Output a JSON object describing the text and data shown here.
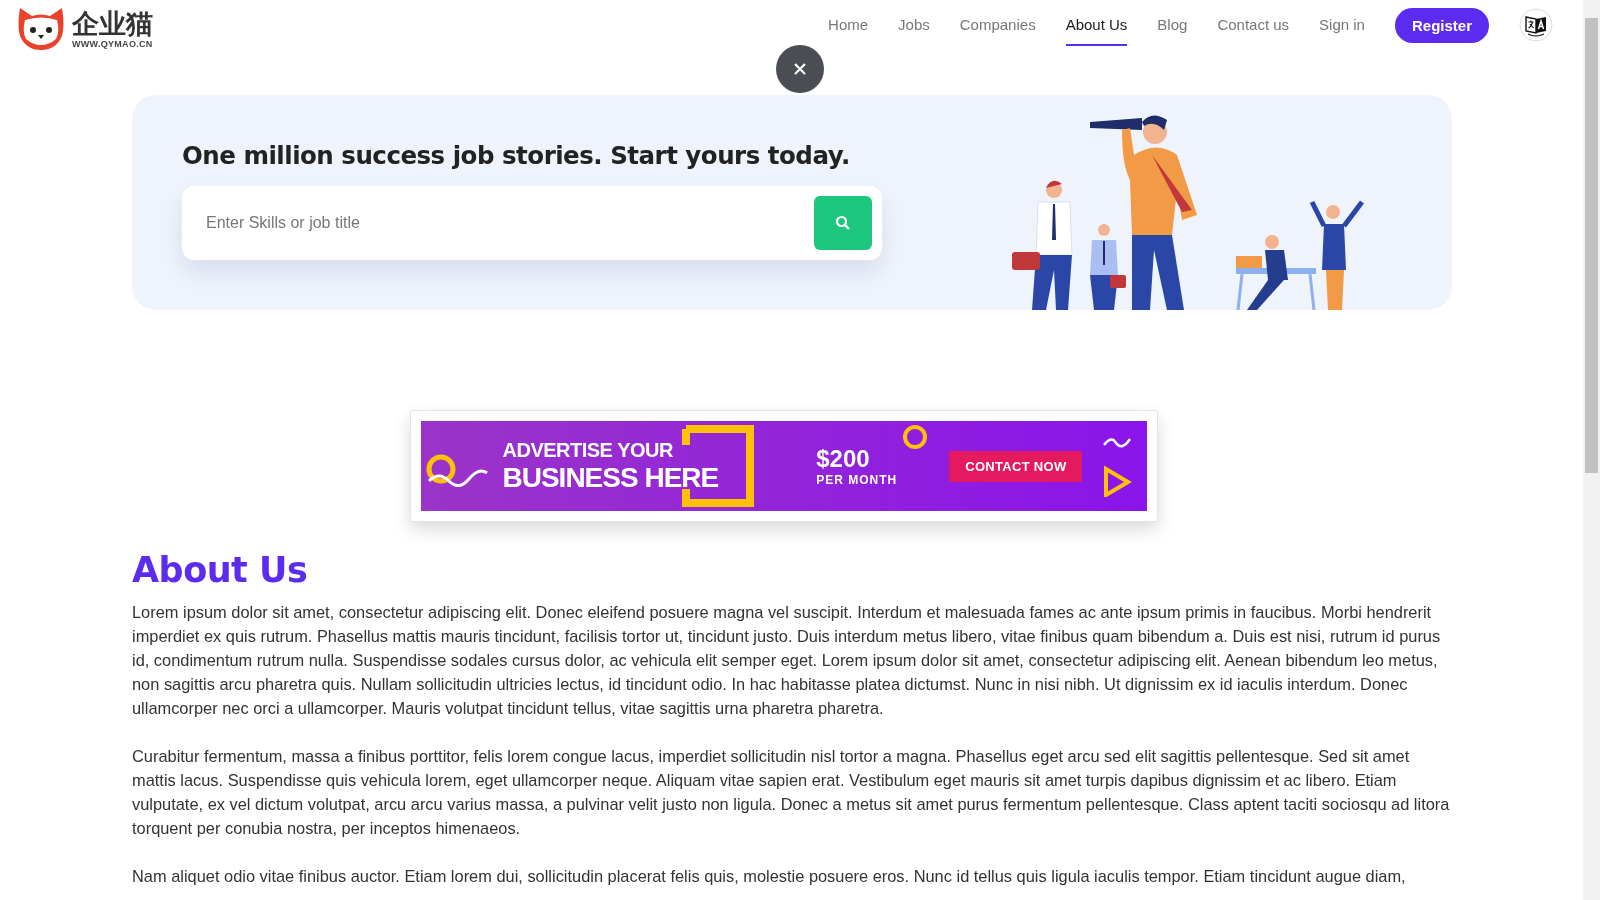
{
  "logo": {
    "name": "企业猫",
    "url": "WWW.QYMAO.CN"
  },
  "nav": {
    "items": [
      {
        "label": "Home",
        "selected": false
      },
      {
        "label": "Jobs",
        "selected": false
      },
      {
        "label": "Companies",
        "selected": false
      },
      {
        "label": "About Us",
        "selected": true
      },
      {
        "label": "Blog",
        "selected": false
      },
      {
        "label": "Contact us",
        "selected": false
      },
      {
        "label": "Sign in",
        "selected": false
      }
    ],
    "register": "Register"
  },
  "hero": {
    "title": "One million success job stories. Start yours today.",
    "search": {
      "placeholder": "Enter Skills or job title"
    }
  },
  "ad": {
    "line1": "ADVERTISE YOUR",
    "line2": "BUSINESS HERE",
    "price": "$200",
    "period": "PER MONTH",
    "cta": "CONTACT NOW"
  },
  "about": {
    "heading": "About Us",
    "paragraphs": [
      "Lorem ipsum dolor sit amet, consectetur adipiscing elit. Donec eleifend posuere magna vel suscipit. Interdum et malesuada fames ac ante ipsum primis in faucibus. Morbi hendrerit imperdiet ex quis rutrum. Phasellus mattis mauris tincidunt, facilisis tortor ut, tincidunt justo. Duis interdum metus libero, vitae finibus quam bibendum a. Duis est nisi, rutrum id purus id, condimentum rutrum nulla. Suspendisse sodales cursus dolor, ac vehicula elit semper eget. Lorem ipsum dolor sit amet, consectetur adipiscing elit. Aenean bibendum leo metus, non sagittis arcu pharetra quis. Nullam sollicitudin ultricies lectus, id tincidunt odio. In hac habitasse platea dictumst. Nunc in nisi nibh. Ut dignissim ex id iaculis interdum. Donec ullamcorper nec orci a ullamcorper. Mauris volutpat tincidunt tellus, vitae sagittis urna pharetra pharetra.",
      "Curabitur fermentum, massa a finibus porttitor, felis lorem congue lacus, imperdiet sollicitudin nisl tortor a magna. Phasellus eget arcu sed elit sagittis pellentesque. Sed sit amet mattis lacus. Suspendisse quis vehicula lorem, eget ullamcorper neque. Aliquam vitae sapien erat. Vestibulum eget mauris sit amet turpis dapibus dignissim et ac libero. Etiam vulputate, ex vel dictum volutpat, arcu arcu varius massa, a pulvinar velit justo non ligula. Donec a metus sit amet purus fermentum pellentesque. Class aptent taciti sociosqu ad litora torquent per conubia nostra, per inceptos himenaeos.",
      "Nam aliquet odio vitae finibus auctor. Etiam lorem dui, sollicitudin placerat felis quis, molestie posuere eros. Nunc id tellus quis ligula iaculis tempor. Etiam tincidunt augue diam,"
    ]
  }
}
